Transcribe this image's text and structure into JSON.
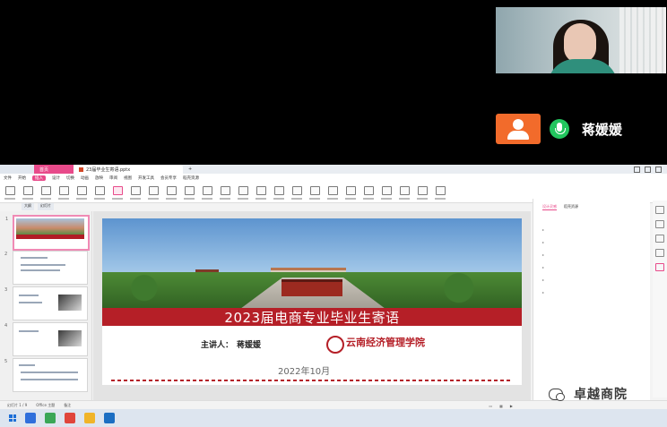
{
  "participant": {
    "name": "蒋媛媛"
  },
  "app": {
    "tabs": [
      "首页",
      "23届毕业生寄语.pptx"
    ],
    "menu": [
      "文件",
      "开始",
      "插入",
      "设计",
      "切换",
      "动画",
      "放映",
      "审阅",
      "视图",
      "开发工具",
      "会员专享",
      "稻壳资源"
    ],
    "active_menu": "插入",
    "subtabs": [
      "大纲",
      "幻灯片"
    ]
  },
  "slide": {
    "title": "2023届电商专业毕业生寄语",
    "presenter_label": "主讲人：",
    "presenter_name": "蒋媛媛",
    "school_name": "云南经济管理学院",
    "date": "2022年10月"
  },
  "thumbnails": [
    "1",
    "2",
    "3",
    "4",
    "5"
  ],
  "right_panel": {
    "tabs": [
      "设计灵感",
      "稻壳资源"
    ]
  },
  "status": {
    "page": "幻灯片 1 / 9",
    "theme": "Office 主题",
    "notes": "备注"
  },
  "watermark": {
    "text": "卓越商院"
  },
  "colors": {
    "accent": "#e84a8a",
    "slide_red": "#b51f27",
    "avatar_orange": "#f26b2b",
    "mic_green": "#22c55e"
  }
}
